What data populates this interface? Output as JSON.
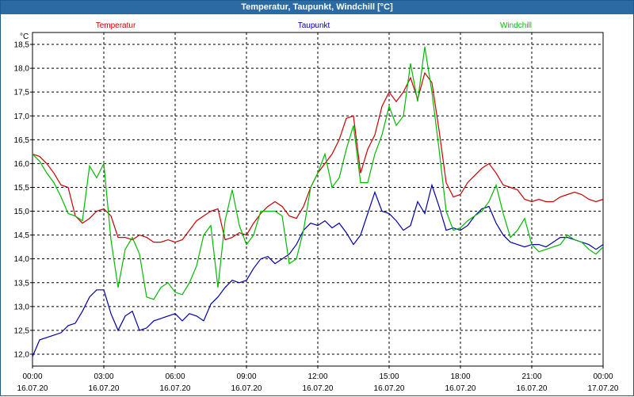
{
  "window": {
    "title": "Temperatur, Taupunkt, Windchill [°C]"
  },
  "chart_data": {
    "type": "line",
    "title": "Temperatur, Taupunkt, Windchill [°C]",
    "ylabel": "°C",
    "ylim": [
      11.75,
      18.75
    ],
    "xlim": [
      0,
      24
    ],
    "grid": true,
    "legend_placement": "top",
    "yticks": [
      "12,0",
      "12,5",
      "13,0",
      "13,5",
      "14,0",
      "14,5",
      "15,0",
      "15,5",
      "16,0",
      "16,5",
      "17,0",
      "17,5",
      "18,0",
      "18,5"
    ],
    "xticks": [
      {
        "time": "00:00",
        "date": "16.07.20"
      },
      {
        "time": "03:00",
        "date": "16.07.20"
      },
      {
        "time": "06:00",
        "date": "16.07.20"
      },
      {
        "time": "09:00",
        "date": "16.07.20"
      },
      {
        "time": "12:00",
        "date": "16.07.20"
      },
      {
        "time": "15:00",
        "date": "16.07.20"
      },
      {
        "time": "18:00",
        "date": "16.07.20"
      },
      {
        "time": "21:00",
        "date": "16.07.20"
      },
      {
        "time": "00:00",
        "date": "17.07.20"
      }
    ],
    "series": [
      {
        "name": "Temperatur",
        "color": "#cc0000",
        "x": [
          0,
          0.3,
          0.6,
          0.9,
          1.2,
          1.5,
          1.8,
          2.1,
          2.4,
          2.7,
          3.0,
          3.3,
          3.6,
          3.9,
          4.2,
          4.5,
          4.8,
          5.1,
          5.4,
          5.7,
          6.0,
          6.3,
          6.6,
          6.9,
          7.2,
          7.5,
          7.8,
          8.1,
          8.4,
          8.7,
          9.0,
          9.3,
          9.6,
          9.9,
          10.2,
          10.5,
          10.8,
          11.1,
          11.4,
          11.7,
          12.0,
          12.3,
          12.6,
          12.9,
          13.2,
          13.5,
          13.8,
          14.1,
          14.4,
          14.7,
          15.0,
          15.3,
          15.6,
          15.9,
          16.2,
          16.5,
          16.8,
          17.1,
          17.4,
          17.7,
          18.0,
          18.3,
          18.6,
          18.9,
          19.2,
          19.5,
          19.8,
          20.1,
          20.4,
          20.7,
          21.0,
          21.3,
          21.6,
          21.9,
          22.2,
          22.5,
          22.8,
          23.1,
          23.4,
          23.7,
          24.0
        ],
        "values": [
          16.2,
          16.15,
          16.0,
          15.8,
          15.55,
          15.5,
          14.9,
          14.75,
          14.85,
          15.0,
          15.05,
          14.9,
          14.45,
          14.45,
          14.4,
          14.5,
          14.45,
          14.35,
          14.35,
          14.4,
          14.35,
          14.4,
          14.6,
          14.8,
          14.9,
          15.0,
          15.05,
          14.4,
          14.45,
          14.55,
          14.5,
          14.75,
          14.95,
          15.1,
          15.2,
          15.1,
          14.9,
          14.85,
          15.1,
          15.5,
          15.8,
          16.0,
          16.2,
          16.5,
          16.95,
          17.0,
          15.8,
          16.3,
          16.6,
          17.2,
          17.5,
          17.3,
          17.5,
          17.8,
          17.35,
          17.9,
          17.7,
          16.7,
          15.6,
          15.3,
          15.35,
          15.6,
          15.75,
          15.9,
          16.0,
          15.8,
          15.55,
          15.5,
          15.45,
          15.25,
          15.2,
          15.25,
          15.2,
          15.2,
          15.3,
          15.35,
          15.4,
          15.35,
          15.25,
          15.2,
          15.25
        ]
      },
      {
        "name": "Taupunkt",
        "color": "#0000aa",
        "x": [
          0,
          0.3,
          0.6,
          0.9,
          1.2,
          1.5,
          1.8,
          2.1,
          2.4,
          2.7,
          3.0,
          3.3,
          3.6,
          3.9,
          4.2,
          4.5,
          4.8,
          5.1,
          5.4,
          5.7,
          6.0,
          6.3,
          6.6,
          6.9,
          7.2,
          7.5,
          7.8,
          8.1,
          8.4,
          8.7,
          9.0,
          9.3,
          9.6,
          9.9,
          10.2,
          10.5,
          10.8,
          11.1,
          11.4,
          11.7,
          12.0,
          12.3,
          12.6,
          12.9,
          13.2,
          13.5,
          13.8,
          14.1,
          14.4,
          14.7,
          15.0,
          15.3,
          15.6,
          15.9,
          16.2,
          16.5,
          16.8,
          17.1,
          17.4,
          17.7,
          18.0,
          18.3,
          18.6,
          18.9,
          19.2,
          19.5,
          19.8,
          20.1,
          20.4,
          20.7,
          21.0,
          21.3,
          21.6,
          21.9,
          22.2,
          22.5,
          22.8,
          23.1,
          23.4,
          23.7,
          24.0
        ],
        "values": [
          11.95,
          12.3,
          12.35,
          12.4,
          12.45,
          12.6,
          12.65,
          12.9,
          13.2,
          13.35,
          13.35,
          12.85,
          12.5,
          12.8,
          12.9,
          12.5,
          12.55,
          12.7,
          12.75,
          12.8,
          12.85,
          12.7,
          12.85,
          12.8,
          12.7,
          13.05,
          13.2,
          13.4,
          13.55,
          13.5,
          13.55,
          13.8,
          14.0,
          14.05,
          13.9,
          14.0,
          14.1,
          14.3,
          14.6,
          14.75,
          14.7,
          14.8,
          14.65,
          14.75,
          14.55,
          14.3,
          14.5,
          14.95,
          15.4,
          15.0,
          14.95,
          14.8,
          14.6,
          14.7,
          15.2,
          14.95,
          15.55,
          15.1,
          14.6,
          14.65,
          14.6,
          14.7,
          14.9,
          15.05,
          15.1,
          14.75,
          14.5,
          14.35,
          14.3,
          14.25,
          14.3,
          14.3,
          14.25,
          14.35,
          14.45,
          14.45,
          14.4,
          14.35,
          14.3,
          14.2,
          14.3
        ]
      },
      {
        "name": "Windchill",
        "color": "#00bb00",
        "x": [
          0,
          0.3,
          0.6,
          0.9,
          1.2,
          1.5,
          1.8,
          2.1,
          2.4,
          2.7,
          3.0,
          3.3,
          3.6,
          3.9,
          4.2,
          4.5,
          4.8,
          5.1,
          5.4,
          5.7,
          6.0,
          6.3,
          6.6,
          6.9,
          7.2,
          7.5,
          7.8,
          8.1,
          8.4,
          8.7,
          9.0,
          9.3,
          9.6,
          9.9,
          10.2,
          10.5,
          10.8,
          11.1,
          11.4,
          11.7,
          12.0,
          12.3,
          12.6,
          12.9,
          13.2,
          13.5,
          13.8,
          14.1,
          14.4,
          14.7,
          15.0,
          15.3,
          15.6,
          15.9,
          16.2,
          16.5,
          16.8,
          17.1,
          17.4,
          17.7,
          18.0,
          18.3,
          18.6,
          18.9,
          19.2,
          19.5,
          19.8,
          20.1,
          20.4,
          20.7,
          21.0,
          21.3,
          21.6,
          21.9,
          22.2,
          22.5,
          22.8,
          23.1,
          23.4,
          23.7,
          24.0
        ],
        "values": [
          16.2,
          16.05,
          15.8,
          15.6,
          15.3,
          14.95,
          14.9,
          14.8,
          15.95,
          15.7,
          16.0,
          14.4,
          13.4,
          14.2,
          14.45,
          14.1,
          13.2,
          13.15,
          13.4,
          13.5,
          13.3,
          13.25,
          13.5,
          13.85,
          14.5,
          14.7,
          13.4,
          14.8,
          15.45,
          14.7,
          14.3,
          14.5,
          15.0,
          15.0,
          15.0,
          14.9,
          13.9,
          14.0,
          14.6,
          15.5,
          15.8,
          16.2,
          15.5,
          15.7,
          16.3,
          16.8,
          15.6,
          15.6,
          16.2,
          16.6,
          17.2,
          16.8,
          17.0,
          18.1,
          17.3,
          18.45,
          17.5,
          16.3,
          15.0,
          14.6,
          14.65,
          14.8,
          14.9,
          15.0,
          15.2,
          15.55,
          14.95,
          14.45,
          14.6,
          14.85,
          14.3,
          14.15,
          14.2,
          14.25,
          14.3,
          14.5,
          14.4,
          14.35,
          14.2,
          14.1,
          14.25
        ]
      }
    ]
  }
}
